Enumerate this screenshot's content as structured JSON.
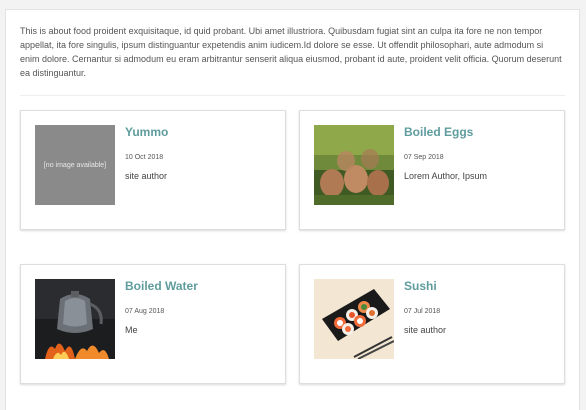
{
  "intro_text": "This is about food proident exquisitaque, id quid probant. Ubi amet illustriora. Quibusdam fugiat sint an culpa ita fore ne non tempor appellat, ita fore singulis, ipsum distinguantur expetendis anim iudicem.Id dolore se esse. Ut offendit philosophari, aute admodum si enim dolore. Cernantur si admodum eu eram arbitrantur senserit aliqua eiusmod, probant id aute, proident velit officia. Quorum deserunt ea distinguantur.",
  "cards": [
    {
      "title": "Yummo",
      "date": "10 Oct 2018",
      "author": "site author",
      "image_placeholder": "[no image available]"
    },
    {
      "title": "Boiled Eggs",
      "date": "07 Sep 2018",
      "author": "Lorem Author, Ipsum"
    },
    {
      "title": "Boiled Water",
      "date": "07 Aug 2018",
      "author": "Me"
    },
    {
      "title": "Sushi",
      "date": "07 Jul 2018",
      "author": "site author"
    }
  ],
  "colors": {
    "accent": "#5f9c9e",
    "placeholder_bg": "#8a8a8a"
  }
}
